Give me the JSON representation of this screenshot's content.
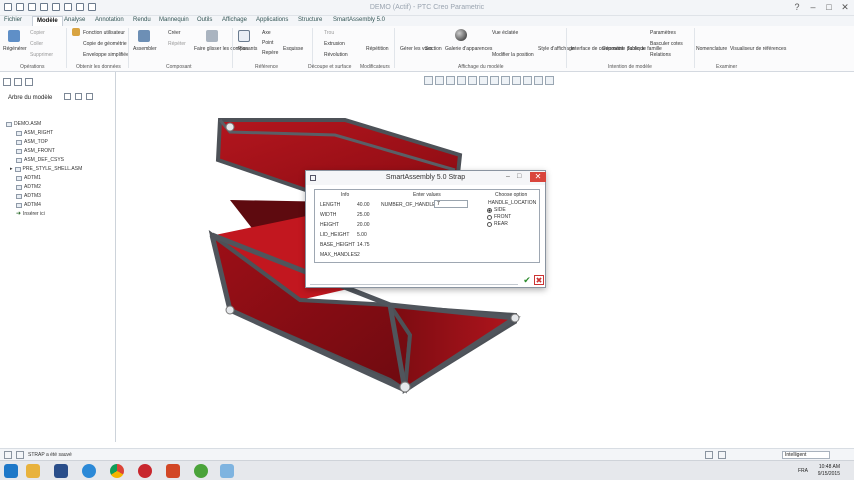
{
  "app": {
    "title": "DEMO (Actif) - PTC Creo Parametric"
  },
  "tabs": [
    {
      "label": "Fichier"
    },
    {
      "label": "Modèle"
    },
    {
      "label": "Analyse"
    },
    {
      "label": "Annotation"
    },
    {
      "label": "Rendu"
    },
    {
      "label": "Mannequin"
    },
    {
      "label": "Outils"
    },
    {
      "label": "Affichage"
    },
    {
      "label": "Applications"
    },
    {
      "label": "Structure"
    },
    {
      "label": "SmartAssembly 5.0"
    }
  ],
  "ribbon": {
    "regenerate": "Régénérer",
    "copy": "Copier",
    "paste": "Coller",
    "delete": "Supprimer",
    "user_defined_feature": "Fonction utilisateur",
    "copy_geometry": "Copie de géométrie",
    "shrinkwrap": "Enveloppe simplifiée",
    "assemble": "Assembler",
    "create": "Créer",
    "assemble_more": "Répéter",
    "drag_components": "Faire glisser les composants",
    "plane": "Plan",
    "axis": "Axe",
    "point": "Point",
    "csys": "Repère",
    "sketch": "Esquisse",
    "hole": "Trou",
    "extrude": "Extrusion",
    "revolve": "Révolution",
    "pattern": "Répétition",
    "manage_views": "Gérer les vues",
    "section": "Section",
    "appearance_gallery": "Galerie d'apparences",
    "exploded_view": "Vue éclatée",
    "edit_position": "Modifier la position",
    "display_style": "Style d'affichage",
    "component_interface": "Interface de composant",
    "bulk_geometry": "Géométrie publique",
    "family_table": "Table de famille",
    "parameters": "Paramètres",
    "switch_dimensions": "Basculer cotes",
    "relations": "Relations",
    "nomenclature": "Nomenclature",
    "reference_viewer": "Visualiseur de références",
    "groups": {
      "operations": "Opérations",
      "get_data": "Obtenir les données",
      "component": "Composant",
      "datum": "Référence",
      "cut_surface": "Découpe et surface",
      "modifiers": "Modificateurs",
      "model_display": "Affichage du modèle",
      "model_intent": "Intention de modèle",
      "investigate": "Examiner"
    }
  },
  "left_panel": {
    "title": "Arbre du modèle",
    "items": [
      {
        "label": "DEMO.ASM"
      },
      {
        "label": "ASM_RIGHT"
      },
      {
        "label": "ASM_TOP"
      },
      {
        "label": "ASM_FRONT"
      },
      {
        "label": "ASM_DEF_CSYS"
      },
      {
        "label": "PRE_STYLE_SHELL.ASM"
      },
      {
        "label": "ADTM1"
      },
      {
        "label": "ADTM2"
      },
      {
        "label": "ADTM3"
      },
      {
        "label": "ADTM4"
      },
      {
        "label": "Insérer ici"
      }
    ]
  },
  "dialog": {
    "title": "SmartAssembly 5.0 Strap",
    "col_info": "Info",
    "col_enter": "Enter values",
    "col_choose": "Choose option",
    "params": [
      {
        "label": "LENGTH",
        "value": "40.00"
      },
      {
        "label": "WIDTH",
        "value": "25.00"
      },
      {
        "label": "HEIGHT",
        "value": "20.00"
      },
      {
        "label": "LID_HEIGHT",
        "value": "5.00"
      },
      {
        "label": "BASE_HEIGHT",
        "value": "14.75"
      },
      {
        "label": "MAX_HANDLES",
        "value": "2"
      }
    ],
    "num_handles_label": "NUMBER_OF_HANDLES",
    "num_handles_value": "7",
    "handle_location_label": "HANDLE_LOCATION",
    "options": [
      {
        "label": "SIDE",
        "selected": true
      },
      {
        "label": "FRONT",
        "selected": false
      },
      {
        "label": "REAR",
        "selected": false
      }
    ],
    "ok_symbol": "✔",
    "cancel_symbol": "✖",
    "close_symbol": "✕",
    "min_symbol": "–",
    "max_symbol": "□"
  },
  "status": {
    "message": "STRAP a été sauvé",
    "filter": "Intelligent"
  },
  "tray": {
    "language": "FRA",
    "time": "10:48 AM",
    "date": "9/15/2015"
  },
  "colors": {
    "box_red": "#8a0b12",
    "box_red_light": "#b0151d",
    "frame": "#4d5157",
    "close_red": "#d9453c",
    "accent": "#1f5fa8"
  }
}
